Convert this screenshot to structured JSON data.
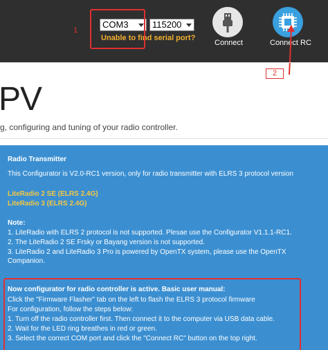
{
  "toolbar": {
    "port_value": "COM3",
    "baud_value": "115200",
    "port_warning": "Unable to find serial port?",
    "connect_label": "Connect",
    "connect_rc_label": "Connect RC"
  },
  "annotations": {
    "num1": "1",
    "num2": "2",
    "color": "#e03030"
  },
  "header": {
    "title": "PV",
    "subtitle": "g, configuring and tuning of your radio controller."
  },
  "panel": {
    "heading": "Radio Transmitter",
    "version_line": "This Configurator is V2.0-RC1 version, only for radio transmitter with ELRS 3 protocol version",
    "model1": "LiteRadio 2 SE (ELRS 2.4G)",
    "model2": "LiteRadio 3 (ELRS 2.4G)",
    "note_heading": "Note:",
    "note1": "1. LiteRadio with ELRS 2 protocol is not supported. Plesae use the Configurator V1.1.1-RC1.",
    "note2": "2. The LiteRadio 2 SE Frsky or Bayang version is not supported.",
    "note3a": "3. LiteRadio 2 and LiteRadio 3 Pro is powered by OpenTX system, please use the OpenTX",
    "note3b": "Companion.",
    "manual_heading": "Now configurator for radio controller is active. Basic user manual:",
    "manual1": "Click the \"Firmware Flasher\" tab on the left to flash the ELRS 3 protocol firmware",
    "manual2": "For configuration, follow the steps below:",
    "manual3": "1. Turn off the radio controller first. Then connect it to the computer via USB data cable.",
    "manual4": "2. Wait for the LED ring breathes in red or green.",
    "manual5": "3. Select the correct COM port and click the \"Connect RC\" button on the top right."
  },
  "colors": {
    "topbar": "#2f2f2f",
    "panel": "#3b8fd1",
    "warning": "#f0b030",
    "connect_rc_icon_bg": "#3aa0e0"
  },
  "icons": {
    "connect": "usb-plug-icon",
    "connect_rc": "chip-icon"
  }
}
